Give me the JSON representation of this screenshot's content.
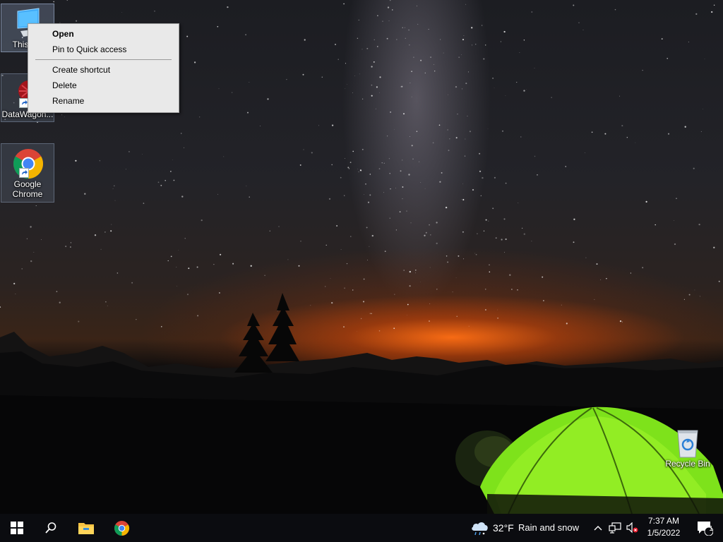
{
  "desktop": {
    "icons": [
      {
        "label": "This PC",
        "selected": true
      },
      {
        "label": "DataWagon...",
        "selected": false
      },
      {
        "label": "Google Chrome",
        "label_line1": "Google",
        "label_line2": "Chrome",
        "selected": false
      },
      {
        "label": "Recycle Bin",
        "selected": false
      }
    ]
  },
  "context_menu": {
    "items": [
      {
        "label": "Open",
        "bold": true
      },
      {
        "label": "Pin to Quick access"
      },
      {
        "label": "Create shortcut"
      },
      {
        "label": "Delete"
      },
      {
        "label": "Rename"
      }
    ]
  },
  "taskbar": {
    "start_icon": "windows-logo-icon",
    "search_icon": "search-icon",
    "pinned": [
      "file-explorer-icon",
      "chrome-icon"
    ],
    "weather": {
      "temperature": "32°F",
      "condition": "Rain and snow",
      "icon": "cloud-rain-snow-icon"
    },
    "tray_icons": [
      "chevron-up-icon",
      "network-icon",
      "volume-muted-icon"
    ],
    "clock": {
      "time": "7:37 AM",
      "date": "1/5/2022"
    },
    "notifications": {
      "count": "1",
      "icon": "action-center-icon"
    }
  }
}
